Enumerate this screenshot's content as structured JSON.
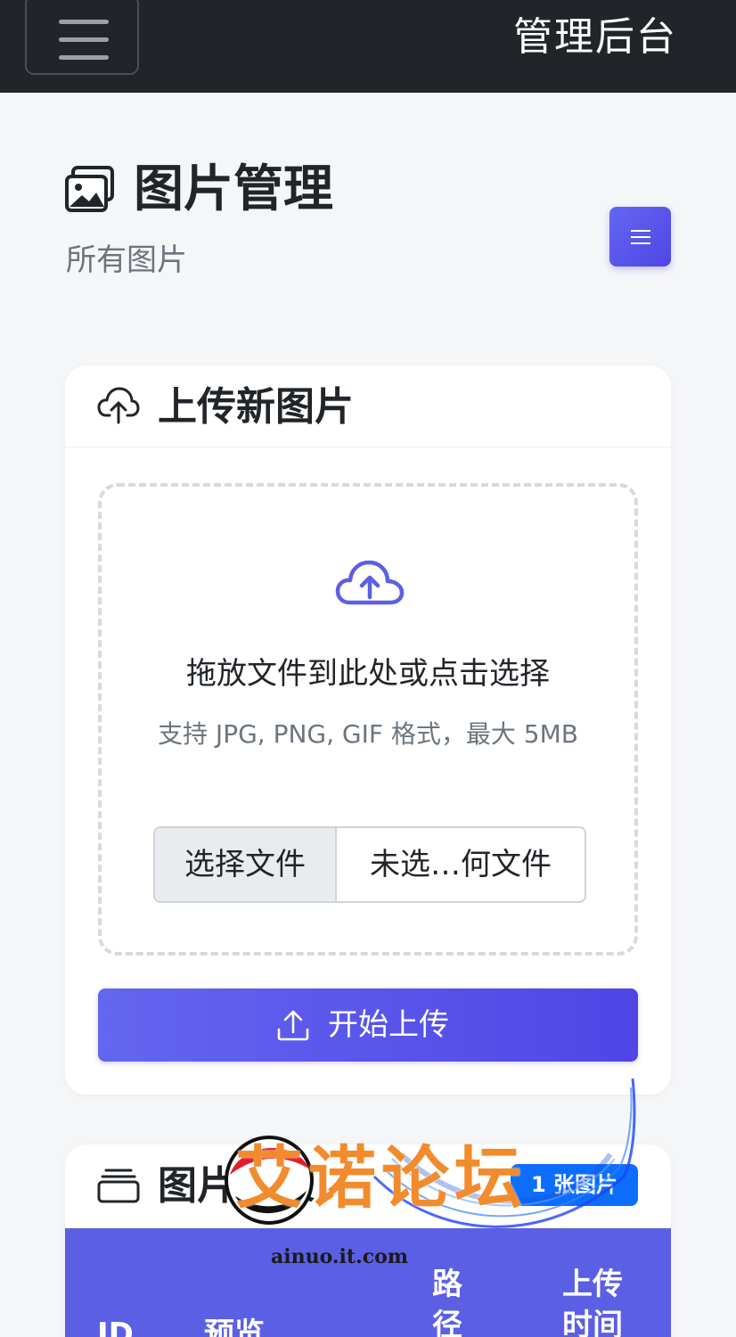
{
  "navbar": {
    "brand": "管理后台",
    "toggle_icon": "hamburger-icon"
  },
  "page": {
    "title": "图片管理",
    "subtitle": "所有图片",
    "title_icon": "images-icon",
    "menu_icon": "list-icon"
  },
  "upload_card": {
    "title": "上传新图片",
    "icon": "cloud-upload-icon",
    "dropzone": {
      "icon": "cloud-upload-icon",
      "title": "拖放文件到此处或点击选择",
      "hint": "支持 JPG, PNG, GIF 格式，最大 5MB"
    },
    "file_input": {
      "button_label": "选择文件",
      "status": "未选…何文件"
    },
    "upload_button": {
      "label": "开始上传",
      "icon": "upload-icon"
    }
  },
  "list_card": {
    "title": "图片列表",
    "icon": "stack-icon",
    "count_badge": "1 张图片",
    "columns": [
      "ID",
      "预览",
      "路径",
      "上传时间"
    ]
  },
  "watermark": {
    "text": "艾诺论坛",
    "url": "ainuo.it.com"
  },
  "colors": {
    "navbar": "#212529",
    "accent": "#5b5fe4",
    "badge": "#0d6efd",
    "watermark": "#f28b2c"
  }
}
